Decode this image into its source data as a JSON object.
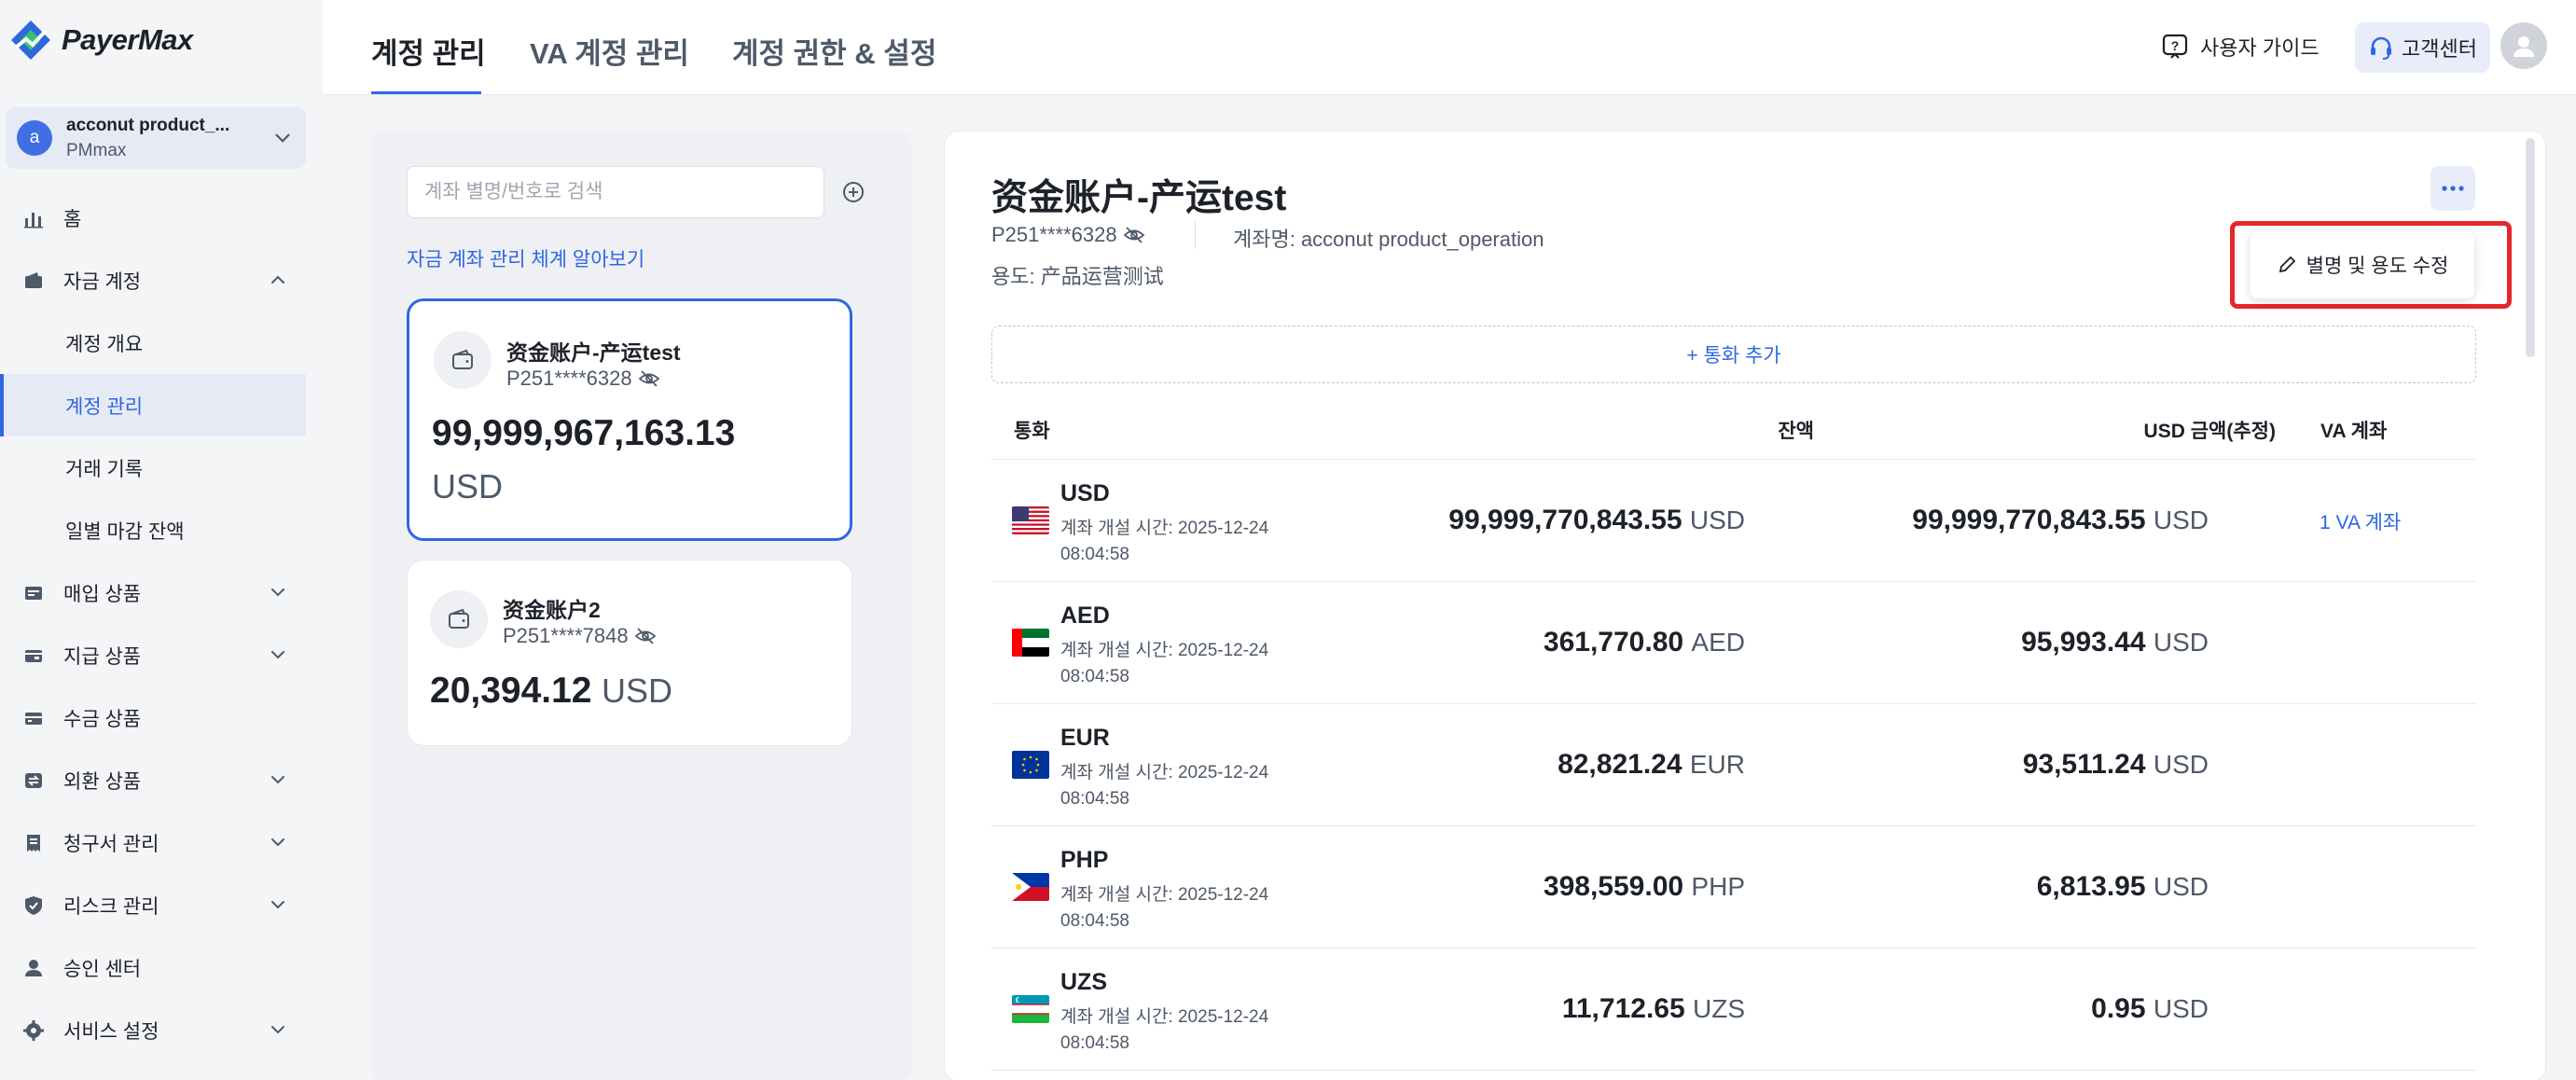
{
  "brand": {
    "name": "PayerMax",
    "accent": "#2f67e0",
    "highlight": "#e5262b"
  },
  "account": {
    "avatar": "a",
    "name": "acconut product_...",
    "sub": "PMmax"
  },
  "nav": {
    "home": "홈",
    "fund_account": "자금 계정",
    "sub": {
      "overview": "계정 개요",
      "management": "계정 관리",
      "transactions": "거래 기록",
      "daily_balance": "일별 마감 잔액"
    },
    "acquiring": "매입 상품",
    "payout": "지급 상품",
    "collection": "수금 상품",
    "fx": "외환 상품",
    "invoice": "청구서 관리",
    "risk": "리스크 관리",
    "approval": "승인 센터",
    "service_settings": "서비스 설정"
  },
  "header": {
    "tabs": [
      "계정 관리",
      "VA 계정 관리",
      "계정 권한 & 설정"
    ],
    "user_guide": "사용자 가이드",
    "customer_center": "고객센터"
  },
  "left": {
    "search_placeholder": "계좌 별명/번호로 검색",
    "learn_link": "자금 계좌 관리 체계 알아보기",
    "accounts": [
      {
        "name": "资金账户-产运test",
        "number": "P251****6328",
        "balance": "99,999,967,163.13",
        "currency": "USD"
      },
      {
        "name": "资金账户2",
        "number": "P251****7848",
        "balance": "20,394.12",
        "currency": "USD"
      }
    ]
  },
  "detail": {
    "title": "资金账户-产运test",
    "number": "P251****6328",
    "owner": "계좌명: acconut product_operation",
    "purpose": "용도: 产品运营测试",
    "edit_button": "별명 및 용도 수정",
    "add_currency": "+ 통화 추가",
    "columns": {
      "currency": "통화",
      "balance": "잔액",
      "usd_amount": "USD 금액(추정)",
      "va_account": "VA 계좌"
    },
    "rows": [
      {
        "code": "USD",
        "open": "계좌 개설 시간: 2025-12-24 08:04:58",
        "balance": "99,999,770,843.55",
        "balance_unit": "USD",
        "usd": "99,999,770,843.55",
        "usd_unit": "USD",
        "va": "1 VA 계좌"
      },
      {
        "code": "AED",
        "open": "계좌 개설 시간: 2025-12-24 08:04:58",
        "balance": "361,770.80",
        "balance_unit": "AED",
        "usd": "95,993.44",
        "usd_unit": "USD",
        "va": ""
      },
      {
        "code": "EUR",
        "open": "계좌 개설 시간: 2025-12-24 08:04:58",
        "balance": "82,821.24",
        "balance_unit": "EUR",
        "usd": "93,511.24",
        "usd_unit": "USD",
        "va": ""
      },
      {
        "code": "PHP",
        "open": "계좌 개설 시간: 2025-12-24 08:04:58",
        "balance": "398,559.00",
        "balance_unit": "PHP",
        "usd": "6,813.95",
        "usd_unit": "USD",
        "va": ""
      },
      {
        "code": "UZS",
        "open": "계좌 개설 시간: 2025-12-24 08:04:58",
        "balance": "11,712.65",
        "balance_unit": "UZS",
        "usd": "0.95",
        "usd_unit": "USD",
        "va": ""
      }
    ]
  }
}
